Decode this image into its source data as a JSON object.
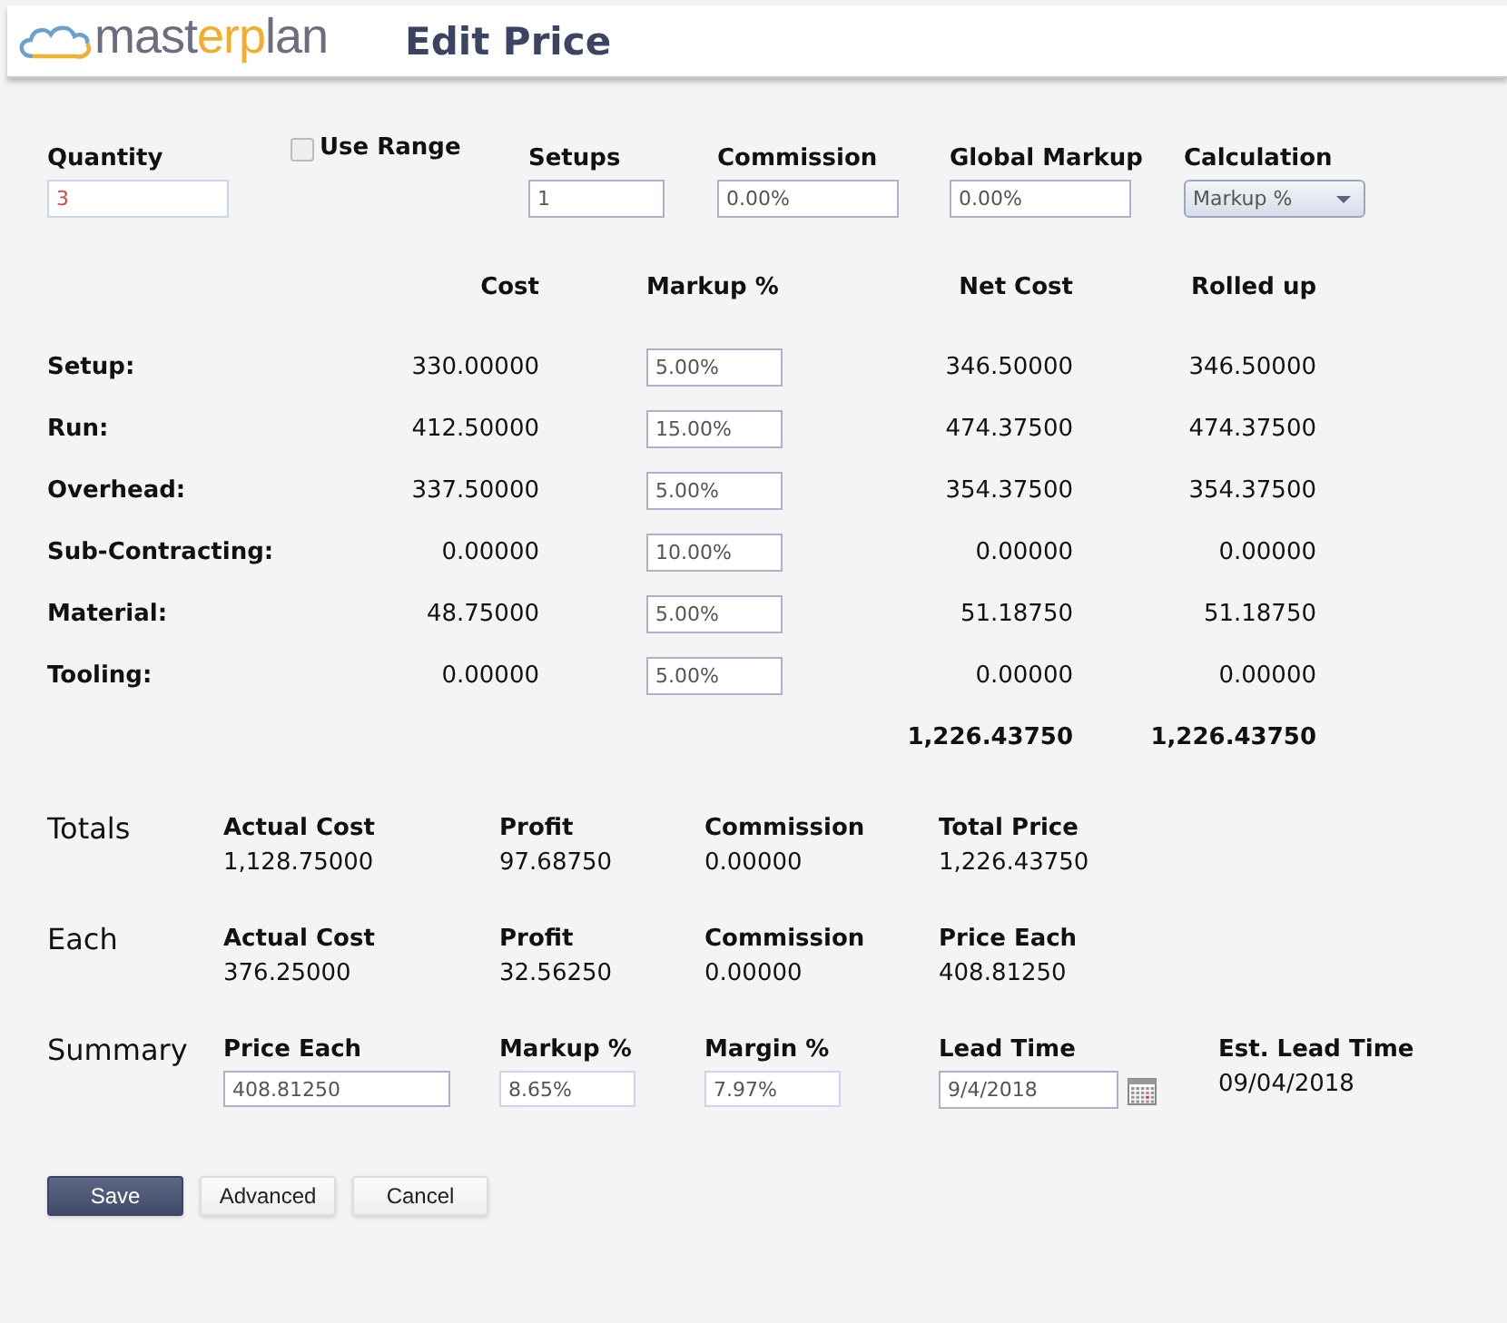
{
  "header": {
    "logo": [
      {
        "text": "mast",
        "accent": false
      },
      {
        "text": "erp",
        "accent": true
      },
      {
        "text": "lan",
        "accent": false
      }
    ],
    "title": "Edit Price"
  },
  "settings": [
    {
      "kind": "input",
      "label": "Quantity",
      "value": "3"
    },
    {
      "kind": "checkbox",
      "label": "Use Range",
      "checked": false
    },
    {
      "kind": "input",
      "label": "Setups",
      "value": "1"
    },
    {
      "kind": "input",
      "label": "Commission",
      "value": "0.00%"
    },
    {
      "kind": "input",
      "label": "Global Markup",
      "value": "0.00%"
    },
    {
      "kind": "select",
      "label": "Calculation",
      "value": "Markup %"
    }
  ],
  "cost_table": {
    "columns": [
      "Cost",
      "Markup %",
      "Net Cost",
      "Rolled up"
    ],
    "rows": [
      {
        "label": "Setup:",
        "cost": "330.00000",
        "markup": "5.00%",
        "net_cost": "346.50000",
        "rolled_up": "346.50000"
      },
      {
        "label": "Run:",
        "cost": "412.50000",
        "markup": "15.00%",
        "net_cost": "474.37500",
        "rolled_up": "474.37500"
      },
      {
        "label": "Overhead:",
        "cost": "337.50000",
        "markup": "5.00%",
        "net_cost": "354.37500",
        "rolled_up": "354.37500"
      },
      {
        "label": "Sub-Contracting:",
        "cost": "0.00000",
        "markup": "10.00%",
        "net_cost": "0.00000",
        "rolled_up": "0.00000"
      },
      {
        "label": "Material:",
        "cost": "48.75000",
        "markup": "5.00%",
        "net_cost": "51.18750",
        "rolled_up": "51.18750"
      },
      {
        "label": "Tooling:",
        "cost": "0.00000",
        "markup": "5.00%",
        "net_cost": "0.00000",
        "rolled_up": "0.00000"
      }
    ],
    "totals": {
      "net_cost": "1,226.43750",
      "rolled_up": "1,226.43750"
    }
  },
  "sections": [
    {
      "title": "Totals",
      "fields": [
        {
          "kind": "text",
          "label": "Actual Cost",
          "value": "1,128.75000"
        },
        {
          "kind": "text",
          "label": "Profit",
          "value": "97.68750"
        },
        {
          "kind": "text",
          "label": "Commission",
          "value": "0.00000"
        },
        {
          "kind": "text",
          "label": "Total Price",
          "value": "1,226.43750"
        }
      ]
    },
    {
      "title": "Each",
      "fields": [
        {
          "kind": "text",
          "label": "Actual Cost",
          "value": "376.25000"
        },
        {
          "kind": "text",
          "label": "Profit",
          "value": "32.56250"
        },
        {
          "kind": "text",
          "label": "Commission",
          "value": "0.00000"
        },
        {
          "kind": "text",
          "label": "Price Each",
          "value": "408.81250"
        }
      ]
    },
    {
      "title": "Summary",
      "fields": [
        {
          "kind": "input",
          "label": "Price Each",
          "value": "408.81250"
        },
        {
          "kind": "input",
          "label": "Markup %",
          "value": "8.65%"
        },
        {
          "kind": "input",
          "label": "Margin %",
          "value": "7.97%"
        },
        {
          "kind": "date",
          "label": "Lead Time",
          "value": "9/4/2018"
        },
        {
          "kind": "text",
          "label": "Est. Lead Time",
          "value": "09/04/2018"
        }
      ]
    }
  ],
  "buttons": [
    {
      "label": "Save",
      "primary": true
    },
    {
      "label": "Advanced",
      "primary": false
    },
    {
      "label": "Cancel",
      "primary": false
    }
  ]
}
